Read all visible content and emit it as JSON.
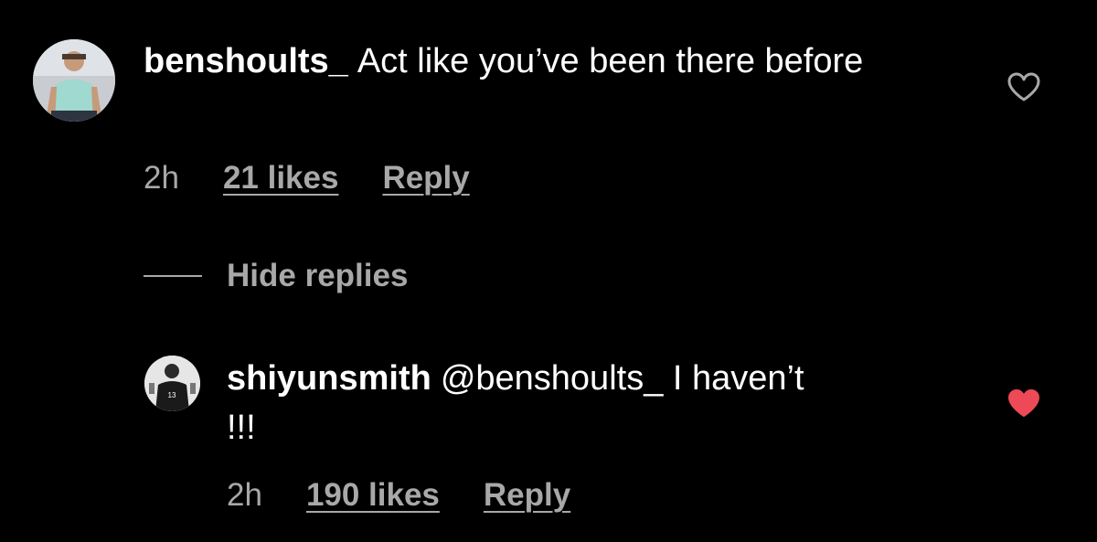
{
  "comments": [
    {
      "username": "benshoults_",
      "text": "Act like you’ve been there before",
      "time": "2h",
      "likes": "21 likes",
      "reply_label": "Reply",
      "liked": false,
      "avatar_icon": "user-avatar-photo"
    }
  ],
  "replies_toggle": {
    "label": "Hide replies"
  },
  "replies": [
    {
      "username": "shiyunsmith",
      "text": "@benshoults_ I haven’t !!!",
      "time": "2h",
      "likes": "190 likes",
      "reply_label": "Reply",
      "liked": true,
      "avatar_icon": "user-avatar-photo"
    }
  ],
  "colors": {
    "background": "#000000",
    "primary_text": "#ffffff",
    "secondary_text": "#a8a8a8",
    "like_red": "#ed4956"
  },
  "icons": {
    "heart_outline": "heart-outline-icon",
    "heart_filled": "heart-filled-icon"
  }
}
